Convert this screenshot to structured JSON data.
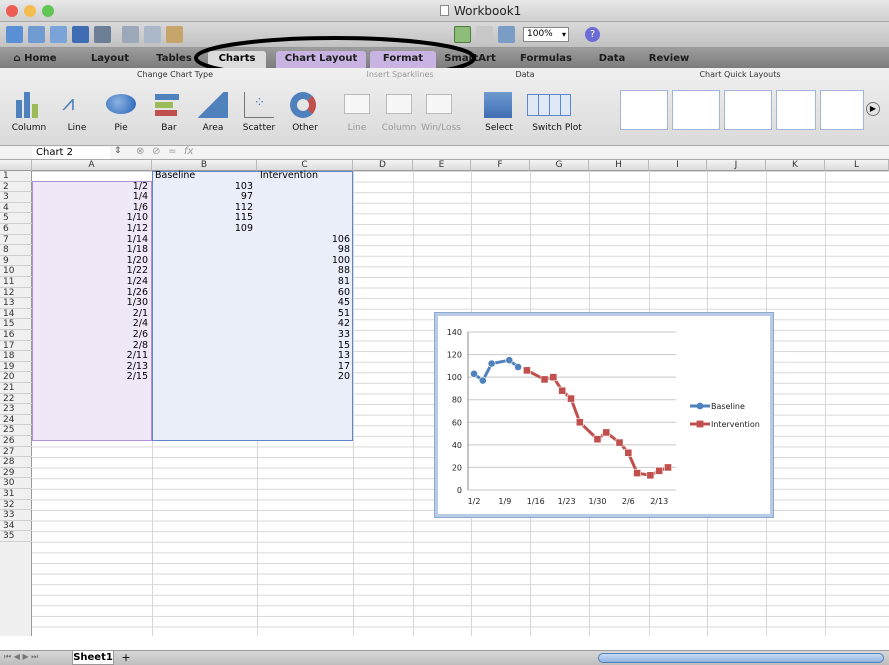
{
  "window": {
    "title": "Workbook1"
  },
  "toolbar": {
    "zoom": "100%"
  },
  "tabs": [
    "Home",
    "Layout",
    "Tables",
    "Charts",
    "Chart Layout",
    "Format",
    "SmartArt",
    "Formulas",
    "Data",
    "Review"
  ],
  "ribbon": {
    "groups": {
      "change_chart_type": "Change Chart Type",
      "insert_sparklines": "Insert Sparklines",
      "data": "Data",
      "quick_layouts": "Chart Quick Layouts"
    },
    "chart_types": [
      "Column",
      "Line",
      "Pie",
      "Bar",
      "Area",
      "Scatter",
      "Other"
    ],
    "sparklines": [
      "Line",
      "Column",
      "Win/Loss"
    ],
    "data_buttons": [
      "Select",
      "Switch Plot"
    ]
  },
  "formula_bar": {
    "name_box": "Chart 2",
    "fx": "fx"
  },
  "columns": [
    "A",
    "B",
    "C",
    "D",
    "E",
    "F",
    "G",
    "H",
    "I",
    "J",
    "K",
    "L"
  ],
  "rows": [
    "1",
    "2",
    "3",
    "4",
    "5",
    "6",
    "7",
    "8",
    "9",
    "10",
    "11",
    "12",
    "13",
    "14",
    "15",
    "16",
    "17",
    "18",
    "19",
    "20",
    "21",
    "22",
    "23",
    "24",
    "25",
    "26",
    "27",
    "28",
    "29",
    "30",
    "31",
    "32",
    "33",
    "34",
    "35"
  ],
  "sheet": {
    "headers": {
      "b": "Baseline",
      "c": "Intervention"
    },
    "dates": [
      "1/2",
      "1/4",
      "1/6",
      "1/10",
      "1/12",
      "1/14",
      "1/18",
      "1/20",
      "1/22",
      "1/24",
      "1/26",
      "1/30",
      "2/1",
      "2/4",
      "2/6",
      "2/8",
      "2/11",
      "2/13",
      "2/15"
    ],
    "baseline": [
      "103",
      "97",
      "112",
      "115",
      "109"
    ],
    "intervention": [
      "106",
      "98",
      "100",
      "88",
      "81",
      "60",
      "45",
      "51",
      "42",
      "33",
      "15",
      "13",
      "17",
      "20"
    ]
  },
  "sheet_tab": "Sheet1",
  "colors": {
    "baseline": "#4f81bd",
    "intervention": "#c0504d",
    "highlight": "#c9b3e2"
  },
  "chart_data": {
    "type": "line",
    "x": [
      "1/2",
      "1/4",
      "1/6",
      "1/10",
      "1/12",
      "1/14",
      "1/18",
      "1/20",
      "1/22",
      "1/24",
      "1/26",
      "1/30",
      "2/1",
      "2/4",
      "2/6",
      "2/8",
      "2/11",
      "2/13",
      "2/15"
    ],
    "series": [
      {
        "name": "Baseline",
        "values": [
          103,
          97,
          112,
          115,
          109,
          null,
          null,
          null,
          null,
          null,
          null,
          null,
          null,
          null,
          null,
          null,
          null,
          null,
          null
        ]
      },
      {
        "name": "Intervention",
        "values": [
          null,
          null,
          null,
          null,
          null,
          106,
          98,
          100,
          88,
          81,
          60,
          45,
          51,
          42,
          33,
          15,
          13,
          17,
          20
        ]
      }
    ],
    "x_ticks": [
      "1/2",
      "1/9",
      "1/16",
      "1/23",
      "1/30",
      "2/6",
      "2/13"
    ],
    "y_ticks": [
      "0",
      "20",
      "40",
      "60",
      "80",
      "100",
      "120",
      "140"
    ],
    "ylim": [
      0,
      140
    ],
    "legend": "right",
    "grid": true
  }
}
